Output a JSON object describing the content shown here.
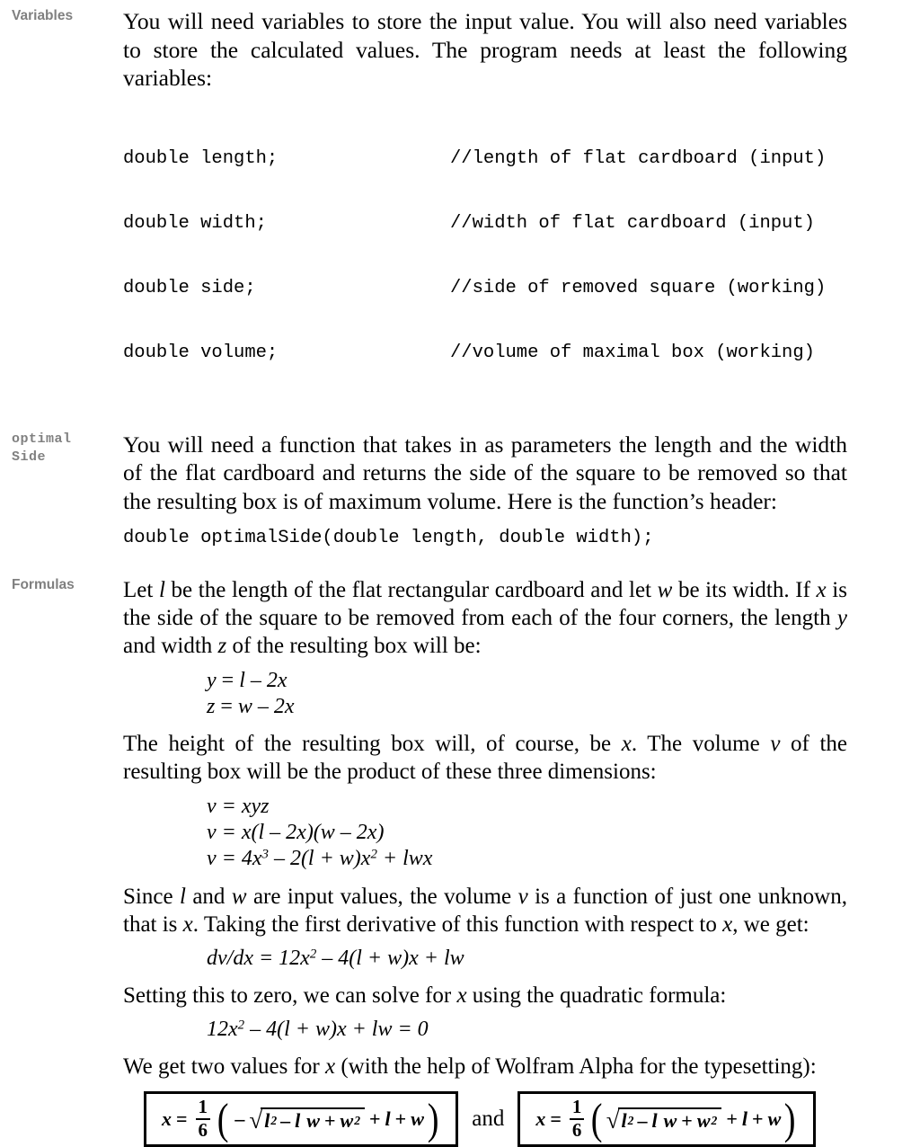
{
  "document": {
    "sections": [
      {
        "margin_label": "Variables",
        "label_style": "sans",
        "paragraph": "You will need variables to store the input value.  You will also need variables to store the calculated values.  The program needs at least the following variables:",
        "code_lines": [
          {
            "decl": "double length;",
            "comment": "//length of flat cardboard (input)"
          },
          {
            "decl": "double width;",
            "comment": "//width of flat cardboard (input)"
          },
          {
            "decl": "double side;",
            "comment": "//side of removed square (working)"
          },
          {
            "decl": "double volume;",
            "comment": "//volume of maximal box (working)"
          }
        ]
      },
      {
        "margin_label": "optimal Side",
        "margin_label_line1": "optimal",
        "margin_label_line2": "Side",
        "label_style": "mono",
        "paragraph": "You will need a function that takes in as parameters the length and the width of the flat cardboard and returns the side of the square to be removed so that the resulting box is of maximum volume.  Here is the function’s header:",
        "signature": "double optimalSide(double length, double width);"
      },
      {
        "margin_label": "Formulas",
        "label_style": "sans"
      }
    ]
  },
  "formulas": {
    "intro_para_1": {
      "a": "Let ",
      "v1": "l",
      "b": " be the length of the flat rectangular cardboard and let ",
      "v2": "w",
      "c": " be its width.  If ",
      "v3": "x",
      "d": " is the side of the square to be removed from each of the four corners, the length ",
      "v4": "y",
      "e": " and width ",
      "v5": "z",
      "f": " of the resulting box will be:"
    },
    "eq_dimensions": [
      {
        "lhs": "y",
        "rel": " = ",
        "rhs_1": "l",
        "rhs_op": " – ",
        "rhs_2": "2x"
      },
      {
        "lhs": "z",
        "rel": " = ",
        "rhs_1": "w",
        "rhs_op": " – ",
        "rhs_2": "2x"
      }
    ],
    "para_height": {
      "a": "The height of the resulting box will, of course, be ",
      "v1": "x",
      "b": ".  The volume ",
      "v2": "v",
      "c": " of the resulting box will be the product of these three dimensions:"
    },
    "eq_volume_1": "v = xyz",
    "eq_volume_2": "v = x(l – 2x)(w – 2x)",
    "eq_volume_3": {
      "pre": "v = 4x",
      "sup1": "3",
      "mid": " – 2(l + w)x",
      "sup2": "2",
      "post": " + lwx"
    },
    "para_derivative": {
      "a": "Since ",
      "v1": "l",
      "b": " and ",
      "v2": "w",
      "c": " are input values, the volume ",
      "v3": "v",
      "d": " is a function of just one unknown, that is ",
      "v4": "x",
      "e": ".  Taking the first derivative of this function with respect to ",
      "v5": "x",
      "f": ", we get:"
    },
    "eq_derivative": {
      "pre": "dv/dx = 12x",
      "sup1": "2",
      "post": " – 4(l + w)x + lw"
    },
    "para_quadratic": {
      "a": "Setting this to zero, we can solve for ",
      "v1": "x",
      "b": " using the quadratic formula:"
    },
    "eq_quadratic": {
      "pre": "12x",
      "sup1": "2",
      "post": " – 4(l + w)x + lw = 0"
    },
    "para_two_values": {
      "a": "We get two values for ",
      "v1": "x",
      "b": " (with the help of Wolfram Alpha for the typesetting):"
    },
    "boxed": {
      "conjunction": "and",
      "left": {
        "lhs": "x",
        "equals": "=",
        "fraction_numerator": "1",
        "fraction_denominator": "6",
        "open_paren": "(",
        "leading_sign": "–",
        "radicand_a": "l",
        "radicand_a_sup": "2",
        "radicand_op1": "–",
        "radicand_b": "l",
        "radicand_c": "w",
        "radicand_op2": "+",
        "radicand_d": "w",
        "radicand_d_sup": "2",
        "tail_op1": "+",
        "tail_a": "l",
        "tail_op2": "+",
        "tail_b": "w",
        "close_paren": ")"
      },
      "right": {
        "lhs": "x",
        "equals": "=",
        "fraction_numerator": "1",
        "fraction_denominator": "6",
        "open_paren": "(",
        "leading_sign": "",
        "radicand_a": "l",
        "radicand_a_sup": "2",
        "radicand_op1": "–",
        "radicand_b": "l",
        "radicand_c": "w",
        "radicand_op2": "+",
        "radicand_d": "w",
        "radicand_d_sup": "2",
        "tail_op1": "+",
        "tail_a": "l",
        "tail_op2": "+",
        "tail_b": "w",
        "close_paren": ")"
      }
    }
  },
  "colors": {
    "margin_label": "#808080",
    "body_text": "#000000",
    "box_border": "#000000",
    "page_background": "#ffffff"
  }
}
